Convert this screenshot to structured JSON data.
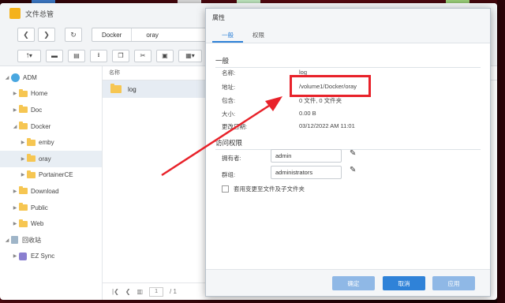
{
  "window": {
    "title": "文件总管"
  },
  "breadcrumb": [
    "Docker",
    "oray"
  ],
  "tree": [
    {
      "label": "ADM",
      "level": 0,
      "type": "disk",
      "expanded": true
    },
    {
      "label": "Home",
      "level": 1,
      "type": "folder"
    },
    {
      "label": "Doc",
      "level": 1,
      "type": "folder"
    },
    {
      "label": "Docker",
      "level": 1,
      "type": "folder",
      "expanded": true
    },
    {
      "label": "emby",
      "level": 2,
      "type": "folder"
    },
    {
      "label": "oray",
      "level": 2,
      "type": "folder",
      "selected": true
    },
    {
      "label": "PortainerCE",
      "level": 2,
      "type": "folder"
    },
    {
      "label": "Download",
      "level": 1,
      "type": "folder"
    },
    {
      "label": "Public",
      "level": 1,
      "type": "folder"
    },
    {
      "label": "Web",
      "level": 1,
      "type": "folder"
    },
    {
      "label": "回收站",
      "level": 0,
      "type": "bin"
    },
    {
      "label": "EZ Sync",
      "level": 1,
      "type": "ez"
    }
  ],
  "list": {
    "column_name": "名称",
    "items": [
      "log"
    ]
  },
  "pager": {
    "page": "1",
    "total": "/ 1"
  },
  "dialog": {
    "title": "属性",
    "tabs": [
      "一般",
      "权限"
    ],
    "general_heading": "一般",
    "fields": [
      {
        "label": "名称:",
        "value": "log"
      },
      {
        "label": "地址:",
        "value": "/volume1/Docker/oray"
      },
      {
        "label": "包含:",
        "value": "0 文件, 0 文件夹"
      },
      {
        "label": "大小:",
        "value": "0.00 B"
      },
      {
        "label": "更改日期:",
        "value": "03/12/2022 AM 11:01"
      }
    ],
    "access_heading": "访问权限",
    "owner_label": "拥有者:",
    "owner_value": "admin",
    "group_label": "群组:",
    "group_value": "administrators",
    "recursive_label": "套用变更至文件及子文件夹",
    "ok": "确定",
    "cancel": "取消",
    "apply": "应用"
  },
  "colors": {
    "accent": "#2f82d8",
    "highlight": "#e8222a",
    "folder": "#f6c652"
  }
}
